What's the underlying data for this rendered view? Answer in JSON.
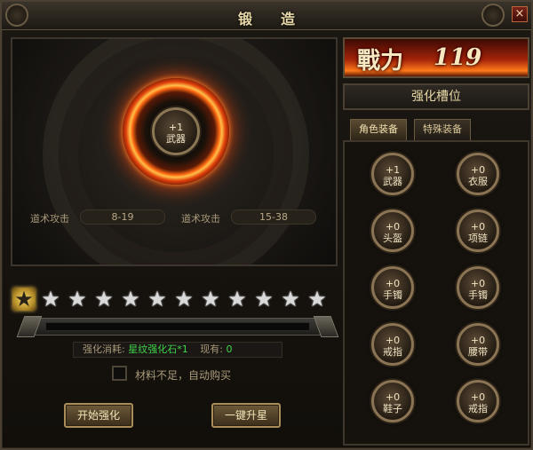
{
  "window": {
    "title": "锻造",
    "close_label": "×"
  },
  "preview": {
    "center_item": {
      "level": "+1",
      "name": "武器"
    },
    "stats": [
      {
        "label": "道术攻击",
        "value": "8-19"
      },
      {
        "label": "道术攻击",
        "value": "15-38"
      }
    ]
  },
  "stars": {
    "total": 12,
    "lit": 1,
    "symbol": "★"
  },
  "progress": {
    "value": 0
  },
  "cost": {
    "label": "强化消耗:",
    "item": "星纹强化石*1",
    "owned_label": "现有:",
    "owned": "0"
  },
  "auto_buy": {
    "label": "材料不足，自动购买",
    "checked": false
  },
  "buttons": {
    "start": "开始强化",
    "one_click": "一键升星"
  },
  "power": {
    "label": "戰力",
    "value": "119"
  },
  "slots_header": "强化槽位",
  "tabs": [
    {
      "label": "角色装备",
      "active": true
    },
    {
      "label": "特殊装备",
      "active": false
    }
  ],
  "slots": [
    {
      "level": "+1",
      "name": "武器"
    },
    {
      "level": "+0",
      "name": "衣服"
    },
    {
      "level": "+0",
      "name": "头盔"
    },
    {
      "level": "+0",
      "name": "项链"
    },
    {
      "level": "+0",
      "name": "手镯"
    },
    {
      "level": "+0",
      "name": "手镯"
    },
    {
      "level": "+0",
      "name": "戒指"
    },
    {
      "level": "+0",
      "name": "腰带"
    },
    {
      "level": "+0",
      "name": "鞋子"
    },
    {
      "level": "+0",
      "name": "戒指"
    }
  ],
  "colors": {
    "accent_gold": "#c8a447",
    "cost_green": "#3fd34a",
    "fire": "#ff6a12"
  }
}
